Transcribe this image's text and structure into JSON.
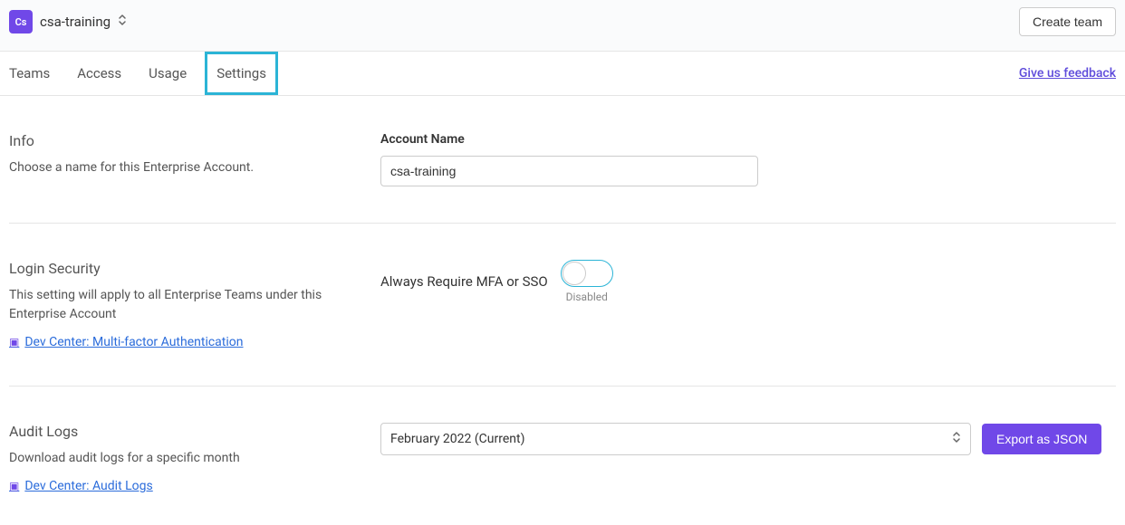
{
  "header": {
    "orgBadge": "Cs",
    "orgName": "csa-training",
    "createTeam": "Create team"
  },
  "tabs": {
    "items": [
      {
        "label": "Teams"
      },
      {
        "label": "Access"
      },
      {
        "label": "Usage"
      },
      {
        "label": "Settings"
      }
    ],
    "feedback": "Give us feedback"
  },
  "info": {
    "title": "Info",
    "desc": "Choose a name for this Enterprise Account.",
    "fieldLabel": "Account Name",
    "value": "csa-training"
  },
  "security": {
    "title": "Login Security",
    "desc": "This setting will apply to all Enterprise Teams under this Enterprise Account",
    "docLink": "Dev Center: Multi-factor Authentication",
    "toggleLabel": "Always Require MFA or SSO",
    "toggleStatus": "Disabled"
  },
  "audit": {
    "title": "Audit Logs",
    "desc": "Download audit logs for a specific month",
    "docLink": "Dev Center: Audit Logs",
    "selected": "February 2022 (Current)",
    "exportBtn": "Export as JSON"
  }
}
